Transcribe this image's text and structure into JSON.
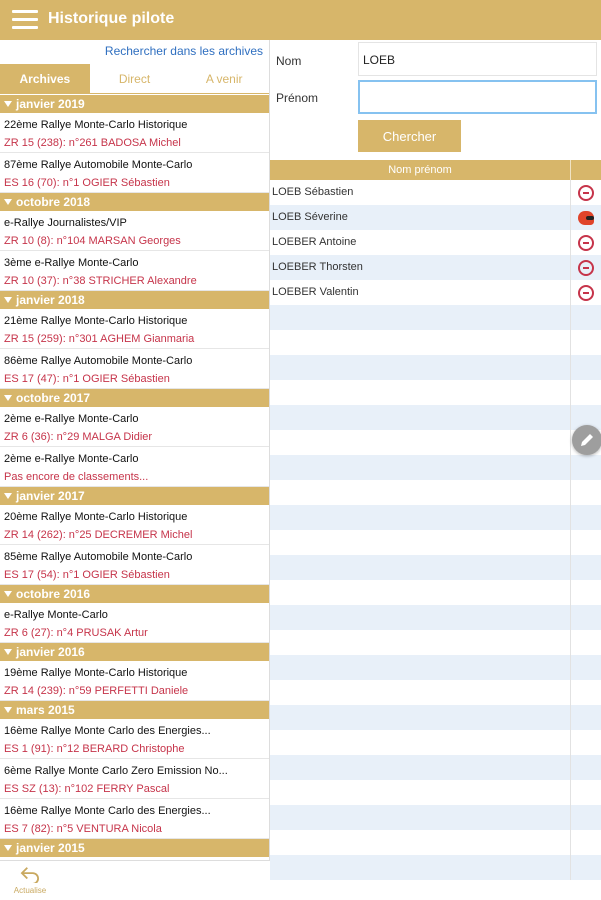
{
  "header": {
    "title": "Historique pilote",
    "menu_icon": "hamburger-menu-icon"
  },
  "left": {
    "search_link": "Rechercher dans les archives",
    "tabs": [
      {
        "label": "Archives",
        "active": true
      },
      {
        "label": "Direct",
        "active": false
      },
      {
        "label": "A venir",
        "active": false
      }
    ],
    "groups": [
      {
        "month": "janvier 2019",
        "items": [
          {
            "title": "22ème Rallye Monte-Carlo Historique",
            "sub": "ZR 15 (238): n°261 BADOSA Michel"
          },
          {
            "title": "87ème Rallye Automobile Monte-Carlo",
            "sub": "ES 16 (70): n°1 OGIER Sébastien"
          }
        ]
      },
      {
        "month": "octobre 2018",
        "items": [
          {
            "title": "e-Rallye Journalistes/VIP",
            "sub": "ZR 10 (8): n°104 MARSAN Georges"
          },
          {
            "title": "3ème e-Rallye Monte-Carlo",
            "sub": "ZR 10 (37): n°38 STRICHER Alexandre"
          }
        ]
      },
      {
        "month": "janvier 2018",
        "items": [
          {
            "title": "21ème Rallye Monte-Carlo Historique",
            "sub": "ZR 15 (259): n°301 AGHEM Gianmaria"
          },
          {
            "title": "86ème Rallye Automobile Monte-Carlo",
            "sub": "ES 17 (47): n°1 OGIER Sébastien"
          }
        ]
      },
      {
        "month": "octobre 2017",
        "items": [
          {
            "title": "2ème e-Rallye Monte-Carlo",
            "sub": "ZR 6 (36): n°29 MALGA Didier"
          },
          {
            "title": "2ème e-Rallye Monte-Carlo",
            "sub": "Pas encore de classements..."
          }
        ]
      },
      {
        "month": "janvier 2017",
        "items": [
          {
            "title": "20ème Rallye Monte-Carlo Historique",
            "sub": "ZR 14 (262): n°25 DECREMER Michel"
          },
          {
            "title": "85ème Rallye Automobile Monte-Carlo",
            "sub": "ES 17 (54): n°1 OGIER Sébastien"
          }
        ]
      },
      {
        "month": "octobre 2016",
        "items": [
          {
            "title": "e-Rallye Monte-Carlo",
            "sub": "ZR 6 (27): n°4 PRUSAK Artur"
          }
        ]
      },
      {
        "month": "janvier 2016",
        "items": [
          {
            "title": "19ème Rallye Monte-Carlo Historique",
            "sub": "ZR 14 (239): n°59 PERFETTI Daniele"
          }
        ]
      },
      {
        "month": "mars 2015",
        "items": [
          {
            "title": "16ème Rallye Monte Carlo des Energies...",
            "sub": "ES 1 (91): n°12 BERARD Christophe"
          },
          {
            "title": "6ème Rallye Monte Carlo Zero Emission No...",
            "sub": "ES SZ (13): n°102 FERRY Pascal"
          },
          {
            "title": "16ème Rallye Monte Carlo des Energies...",
            "sub": "ES 7 (82): n°5 VENTURA Nicola"
          }
        ]
      },
      {
        "month": "janvier 2015",
        "items": []
      }
    ],
    "refresh_label": "Actualise"
  },
  "form": {
    "nom_label": "Nom",
    "nom_value": "LOEB",
    "prenom_label": "Prénom",
    "prenom_value": "",
    "search_button": "Chercher"
  },
  "results": {
    "column_header": "Nom prénom",
    "rows": [
      {
        "name": "LOEB Sébastien",
        "icon": "steering-wheel-icon"
      },
      {
        "name": "LOEB Séverine",
        "icon": "helmet-icon"
      },
      {
        "name": "LOEBER Antoine",
        "icon": "steering-wheel-icon"
      },
      {
        "name": "LOEBER Thorsten",
        "icon": "steering-wheel-icon"
      },
      {
        "name": "LOEBER Valentin",
        "icon": "steering-wheel-icon"
      }
    ],
    "empty_rows": 23
  },
  "fab_icon": "edit-pencil-icon",
  "colors": {
    "accent": "#d7b66a",
    "link": "#2f6fc0",
    "result_red": "#c6344a",
    "row_alt": "#e8f0f9"
  }
}
